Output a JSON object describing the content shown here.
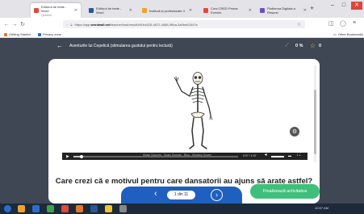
{
  "browser": {
    "tabs": [
      {
        "title": "Editorul de teste - Word",
        "subtitle": "Quizizz",
        "color": "#e04a3a"
      },
      {
        "title": "Editorul de teste - Word",
        "color": "#2b5797"
      },
      {
        "title": "Instituții și profesionale 4",
        "color": "#f2a12b"
      },
      {
        "title": "Curs CRED Primar Evenim",
        "color": "#e6463a"
      },
      {
        "title": "Platforma Digitala a Resursi",
        "color": "#6b4fbb"
      }
    ],
    "url": {
      "prefix": "https://app.",
      "domain": "wordwall.net",
      "rest": "/teacher/task/result/bf1b4625-4672-4468-98ba-3a0be61647a"
    },
    "bookmarks": [
      {
        "label": "Getting Started",
        "color": "#e8762b"
      },
      {
        "label": "Privacy zone",
        "color": "#2b6cd4"
      }
    ],
    "other_bookmarks": "Other Bookmarks"
  },
  "app": {
    "title": "Aventurile lui Cepelică (stimularea gustului pentru lectură)",
    "progress_pct": "0 %",
    "points": "0"
  },
  "video": {
    "caption_text": "Music Sources - Scary Sounds - Bloo - Monkey Grown",
    "time": "0:07 / 1:37",
    "progress_fraction": 0.05
  },
  "question": "Care crezi că e motivul pentru care dansatorii au ajuns să arate astfel?",
  "pager": {
    "label": "1 din 11"
  },
  "finish_label": "Finalizează activitatea",
  "taskbar": {
    "tray_text": "10:57 AM",
    "icons": [
      "#f2a12b",
      "#2b6cd4",
      "#3fa04b",
      "#e04a3a",
      "#e8762b",
      "#2b5797",
      "#f4c430",
      "#888888"
    ]
  },
  "colors": {
    "header": "#3f4755",
    "pager": "#1f5fbf",
    "finish": "#3fc07a"
  }
}
